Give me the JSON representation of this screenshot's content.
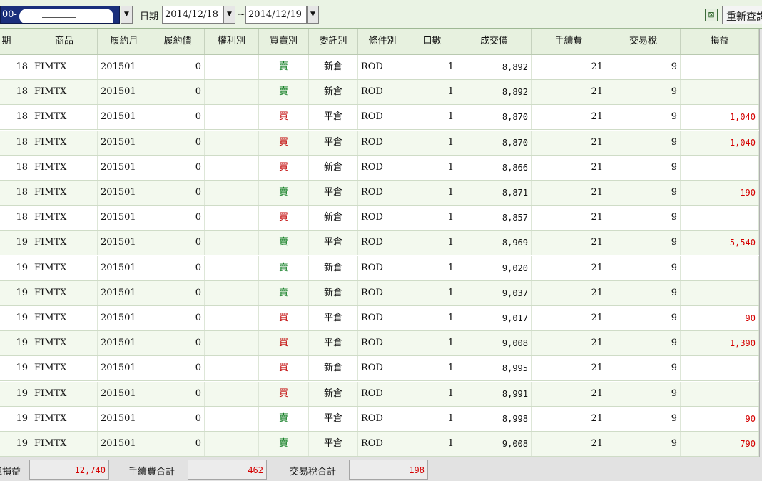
{
  "toolbar": {
    "account_prefix": "00-",
    "date_label": "日期",
    "date_from": "2014/12/18",
    "date_sep": "~",
    "date_to": "2014/12/19",
    "requery_label": "重新查詢",
    "dropdown_glyph": "▼",
    "export_icon": "excel-export-icon",
    "export_glyph": "⊠"
  },
  "table": {
    "columns": [
      "期",
      "商品",
      "履約月",
      "履約價",
      "權利別",
      "買賣別",
      "委託別",
      "條件別",
      "口數",
      "成交價",
      "手續費",
      "交易稅",
      "損益"
    ],
    "rows": [
      {
        "date": "18",
        "product": "FIMTX",
        "month": "201501",
        "strike": "0",
        "right": "",
        "side": "賣",
        "side_type": "sell",
        "order": "新倉",
        "cond": "ROD",
        "qty": "1",
        "price": "8,892",
        "fee": "21",
        "tax": "9",
        "pnl": ""
      },
      {
        "date": "18",
        "product": "FIMTX",
        "month": "201501",
        "strike": "0",
        "right": "",
        "side": "賣",
        "side_type": "sell",
        "order": "新倉",
        "cond": "ROD",
        "qty": "1",
        "price": "8,892",
        "fee": "21",
        "tax": "9",
        "pnl": ""
      },
      {
        "date": "18",
        "product": "FIMTX",
        "month": "201501",
        "strike": "0",
        "right": "",
        "side": "買",
        "side_type": "buy",
        "order": "平倉",
        "cond": "ROD",
        "qty": "1",
        "price": "8,870",
        "fee": "21",
        "tax": "9",
        "pnl": "1,040"
      },
      {
        "date": "18",
        "product": "FIMTX",
        "month": "201501",
        "strike": "0",
        "right": "",
        "side": "買",
        "side_type": "buy",
        "order": "平倉",
        "cond": "ROD",
        "qty": "1",
        "price": "8,870",
        "fee": "21",
        "tax": "9",
        "pnl": "1,040"
      },
      {
        "date": "18",
        "product": "FIMTX",
        "month": "201501",
        "strike": "0",
        "right": "",
        "side": "買",
        "side_type": "buy",
        "order": "新倉",
        "cond": "ROD",
        "qty": "1",
        "price": "8,866",
        "fee": "21",
        "tax": "9",
        "pnl": ""
      },
      {
        "date": "18",
        "product": "FIMTX",
        "month": "201501",
        "strike": "0",
        "right": "",
        "side": "賣",
        "side_type": "sell",
        "order": "平倉",
        "cond": "ROD",
        "qty": "1",
        "price": "8,871",
        "fee": "21",
        "tax": "9",
        "pnl": "190"
      },
      {
        "date": "18",
        "product": "FIMTX",
        "month": "201501",
        "strike": "0",
        "right": "",
        "side": "買",
        "side_type": "buy",
        "order": "新倉",
        "cond": "ROD",
        "qty": "1",
        "price": "8,857",
        "fee": "21",
        "tax": "9",
        "pnl": ""
      },
      {
        "date": "19",
        "product": "FIMTX",
        "month": "201501",
        "strike": "0",
        "right": "",
        "side": "賣",
        "side_type": "sell",
        "order": "平倉",
        "cond": "ROD",
        "qty": "1",
        "price": "8,969",
        "fee": "21",
        "tax": "9",
        "pnl": "5,540"
      },
      {
        "date": "19",
        "product": "FIMTX",
        "month": "201501",
        "strike": "0",
        "right": "",
        "side": "賣",
        "side_type": "sell",
        "order": "新倉",
        "cond": "ROD",
        "qty": "1",
        "price": "9,020",
        "fee": "21",
        "tax": "9",
        "pnl": ""
      },
      {
        "date": "19",
        "product": "FIMTX",
        "month": "201501",
        "strike": "0",
        "right": "",
        "side": "賣",
        "side_type": "sell",
        "order": "新倉",
        "cond": "ROD",
        "qty": "1",
        "price": "9,037",
        "fee": "21",
        "tax": "9",
        "pnl": ""
      },
      {
        "date": "19",
        "product": "FIMTX",
        "month": "201501",
        "strike": "0",
        "right": "",
        "side": "買",
        "side_type": "buy",
        "order": "平倉",
        "cond": "ROD",
        "qty": "1",
        "price": "9,017",
        "fee": "21",
        "tax": "9",
        "pnl": "90"
      },
      {
        "date": "19",
        "product": "FIMTX",
        "month": "201501",
        "strike": "0",
        "right": "",
        "side": "買",
        "side_type": "buy",
        "order": "平倉",
        "cond": "ROD",
        "qty": "1",
        "price": "9,008",
        "fee": "21",
        "tax": "9",
        "pnl": "1,390"
      },
      {
        "date": "19",
        "product": "FIMTX",
        "month": "201501",
        "strike": "0",
        "right": "",
        "side": "買",
        "side_type": "buy",
        "order": "新倉",
        "cond": "ROD",
        "qty": "1",
        "price": "8,995",
        "fee": "21",
        "tax": "9",
        "pnl": ""
      },
      {
        "date": "19",
        "product": "FIMTX",
        "month": "201501",
        "strike": "0",
        "right": "",
        "side": "買",
        "side_type": "buy",
        "order": "新倉",
        "cond": "ROD",
        "qty": "1",
        "price": "8,991",
        "fee": "21",
        "tax": "9",
        "pnl": ""
      },
      {
        "date": "19",
        "product": "FIMTX",
        "month": "201501",
        "strike": "0",
        "right": "",
        "side": "賣",
        "side_type": "sell",
        "order": "平倉",
        "cond": "ROD",
        "qty": "1",
        "price": "8,998",
        "fee": "21",
        "tax": "9",
        "pnl": "90"
      },
      {
        "date": "19",
        "product": "FIMTX",
        "month": "201501",
        "strike": "0",
        "right": "",
        "side": "賣",
        "side_type": "sell",
        "order": "平倉",
        "cond": "ROD",
        "qty": "1",
        "price": "9,008",
        "fee": "21",
        "tax": "9",
        "pnl": "790"
      }
    ]
  },
  "footer": {
    "total_pnl_label": "總損益",
    "total_pnl": "12,740",
    "total_fee_label": "手續費合計",
    "total_fee": "462",
    "total_tax_label": "交易稅合計",
    "total_tax": "198"
  },
  "colors": {
    "buy": "#c00000",
    "sell": "#0a7a1c",
    "pnl": "#d40000",
    "header_bg": "#e7f1df",
    "row_alt_bg": "#f3f9ee",
    "account_bg": "#1a2f7c"
  }
}
